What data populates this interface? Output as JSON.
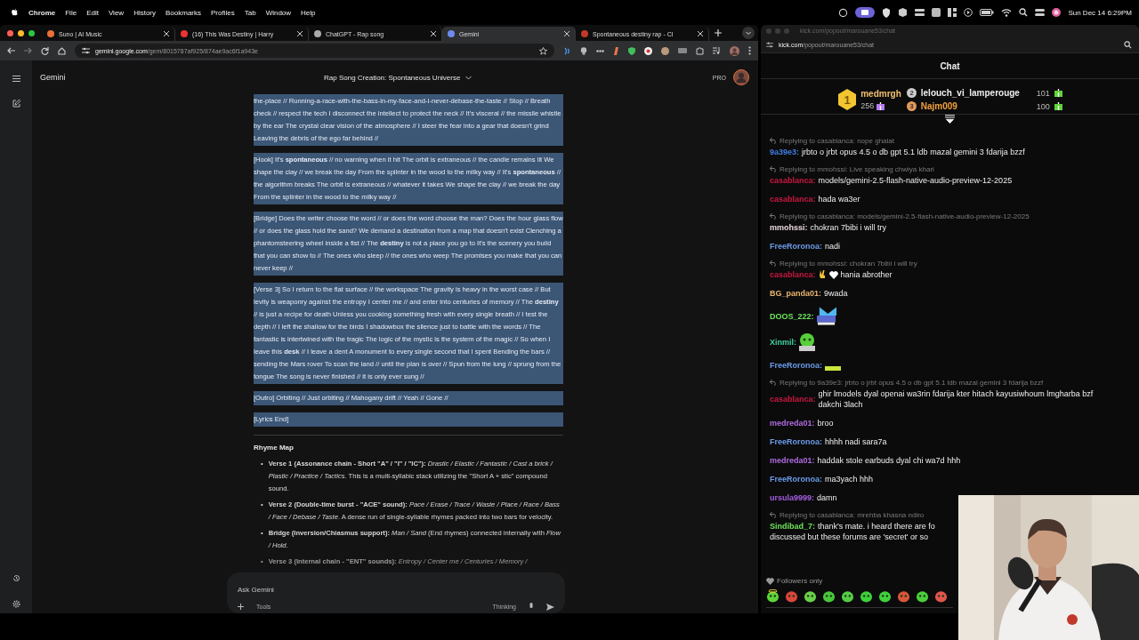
{
  "menu_bar": {
    "app": "Chrome",
    "items": [
      "File",
      "Edit",
      "View",
      "History",
      "Bookmarks",
      "Profiles",
      "Tab",
      "Window",
      "Help"
    ],
    "clock": "Sun Dec 14 6:29PM"
  },
  "browser": {
    "tabs": [
      {
        "title": "Suno | AI Music",
        "selected": false
      },
      {
        "title": "(16) This Was Destiny | Harry",
        "selected": false
      },
      {
        "title": "ChatGPT - Rap song",
        "selected": false
      },
      {
        "title": "Gemini",
        "selected": true
      },
      {
        "title": "Spontaneous destiny rap - Cl",
        "selected": false
      }
    ],
    "url_host": "gemini.google.com",
    "url_path": "/gem/8015787af925/874ae9ac6f1a943e"
  },
  "gemini": {
    "app_name": "Gemini",
    "chat_title": "Rap Song Creation: Spontaneous Universe",
    "plan_badge": "PRO",
    "lyrics": {
      "highlighted": true,
      "paragraphs": [
        "the-place // Running-a-race-with-the-bass-in-my-face-and-I-never-debase-the-taste // Stop // Breath check // respect the tech I disconnect the intellect to protect the neck // It's visceral // the missile whistle by the ear The crystal clear vision of the atmosphere // I steer the fear into a gear that doesn't grind Leaving the debris of the ego far behind //",
        "[Hook] It's **spontaneous** // no warning when it hit The orbit is extraneous // the candle remains lit We shape the clay // we break the day From the splinter in the wood to the milky way // It's **spontaneous** // the algorithm breaks The orbit is extraneous // whatever it takes We shape the clay // we break the day From the splinter in the wood to the milky way //",
        "[Bridge] Does the writer choose the word // or does the word choose the man? Does the hour glass flow // or does the glass hold the sand? We demand a destination from a map that doesn't exist Clenching a phantomsteering wheel inside a fist // The **destiny** is not a place you go to It's the scenery you build that you can show to // The ones who sleep // the ones who weep The promises you make that you can never keep //",
        "[Verse 3] So I return to the flat surface // the workspace The gravity is heavy in the worst case // But levity is weaponry against the entropy I center me // and enter into centuries of memory // The **destiny** // is just a recipe for death Unless you cooking something fresh with every single breath // I test the depth // I left the shallow for the birds I shadowbox the silence just to battle with the words // The fantastic is intertwined with the tragic The logic of the mystic is the system of the magic // So when I leave this **desk** // I leave a dent A monument to every single second that I spent Bending the bars // sending the Mars rover To scan the land // until the plan is over // Spun from the lung // sprung from the tongue The song is never finished // it is only ever sung //",
        "[Outro] Orbiting // Just orbiting // Mahogany drift // Yeah // Gone //",
        "[Lyrics End]"
      ]
    },
    "rhyme_map": {
      "heading": "Rhyme Map",
      "items": [
        {
          "text": "**Verse 1 (Assonance chain - Short \"A\" / \"I\" / \"IC\"):** *Drastic / Elastic / Fantastic / Cast a brick / Plastic / Practice / Tactics*. This is a multi-syllabic stack utilizing the \"Short A + stic\" compound sound.",
          "marker": "•",
          "faded": false
        },
        {
          "text": "**Verse 2 (Double-time burst - \"ACE\" sound):** *Pace / Erase / Trace / Waste / Place / Race / Bass / Face / Debase / Taste*. A dense run of single-syllable rhymes packed into two bars for velocity.",
          "marker": "•",
          "faded": false
        },
        {
          "text": "**Bridge (Inversion/Chiasmus support):** *Man / Sand* (End rhymes) connected internally with *Flow / Hold*.",
          "marker": "•",
          "faded": false
        },
        {
          "text": "**Verse 3 (Internal chain - \"ENT\" sounds):** *Entropy / Center me / Centuries / Memory /*",
          "marker": "•",
          "faded": true
        }
      ]
    },
    "prompt": {
      "placeholder": "Ask Gemini",
      "tools_label": "Tools",
      "mode": "Thinking"
    }
  },
  "kick": {
    "title_url": "kick.com/popout/marouane53/chat",
    "url_host": "kick.com",
    "url_path": "/popout/marouane53/chat",
    "header": "Chat",
    "leaderboard": [
      {
        "rank": "1",
        "name": "medmrgh",
        "count": "256"
      },
      {
        "rank": "2",
        "name": "lelouch_vi_lamperouge",
        "count": "101"
      },
      {
        "rank": "3",
        "name": "Najm009",
        "count": "100"
      }
    ],
    "messages": [
      {
        "kind": "text",
        "reply": "Replying to casablanca: nope ghalat",
        "user": "9a39e3:",
        "color": "#3d7fe0",
        "text": "jrbto o jrbt opus 4.5 o db gpt 5.1 ldb mazal gemini 3 fdarija bzzf"
      },
      {
        "kind": "text",
        "reply": "Replying to mmohssi: Live speaking chwiya khari",
        "user": "casablanca:",
        "color": "#c8183f",
        "text": "models/gemini-2.5-flash-native-audio-preview-12-2025"
      },
      {
        "kind": "text",
        "user": "casablanca:",
        "color": "#c8183f",
        "text": "hada wa3er"
      },
      {
        "kind": "text",
        "reply": "Replying to casablanca: models/gemini-2.5-flash-native-audio-preview-12-2025",
        "user": "mmohssi:",
        "color": "#ead7df",
        "text": "chokran 7bibi i will try"
      },
      {
        "kind": "text",
        "user": "FreeRoronoa:",
        "color": "#6c9be8",
        "text": "nadi"
      },
      {
        "kind": "emoji",
        "reply": "Replying to mmohssi: chokran 7bibi i will try",
        "user": "casablanca:",
        "color": "#c8183f",
        "text": "hania abrother"
      },
      {
        "kind": "text",
        "user": "BG_panda01:",
        "color": "#e8b56c",
        "text": "9wada"
      },
      {
        "kind": "emote",
        "user": "DOOS_222:",
        "color": "#6ee35a"
      },
      {
        "kind": "emote",
        "user": "Xinmil:",
        "color": "#3fd3a0"
      },
      {
        "kind": "emote",
        "user": "FreeRoronoa:",
        "color": "#6c9be8"
      },
      {
        "kind": "text",
        "reply": "Replying to 9a39e3: jrbto o jrbt opus 4.5 o db gpt 5.1 ldb mazal gemini 3 fdarija bzzf",
        "user": "casablanca:",
        "color": "#c8183f",
        "text": "ghir lmodels dyal openai wa3rin fdarija kter hitach kayusiwhoum lmgharba bzf dakchi 3lach"
      },
      {
        "kind": "text",
        "user": "medreda01:",
        "color": "#b06be0",
        "text": "broo"
      },
      {
        "kind": "text",
        "user": "FreeRoronoa:",
        "color": "#6c9be8",
        "text": "hhhh nadi sara7a"
      },
      {
        "kind": "text",
        "user": "medreda01:",
        "color": "#b06be0",
        "text": "haddak stole earbuds dyal chi wa7d hhh"
      },
      {
        "kind": "text",
        "user": "FreeRoronoa:",
        "color": "#6c9be8",
        "text": "ma3yach hhh"
      },
      {
        "kind": "text",
        "user": "ursula9999:",
        "color": "#a35fe0",
        "text": "damn"
      },
      {
        "kind": "text",
        "reply": "Replying to casablanca: mrehba khasna ndiro",
        "user": "Sindibad_7:",
        "color": "#6ee35a",
        "text": "thank's mate. i heard there are fo",
        "text_continued": "discussed but these forums are 'secret' or so"
      }
    ],
    "followers_only": "Followers only"
  }
}
